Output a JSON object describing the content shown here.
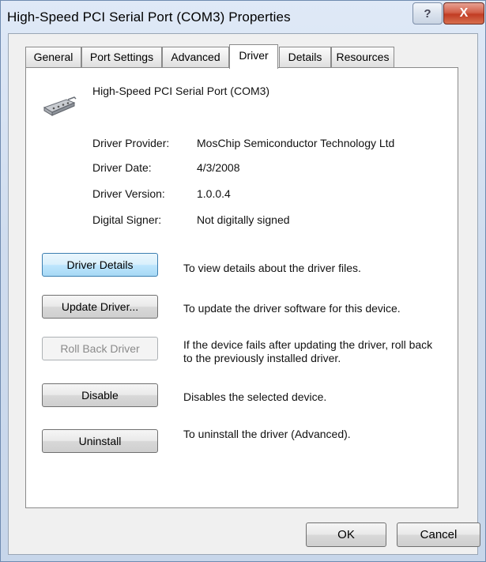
{
  "window": {
    "title": "High-Speed PCI Serial Port (COM3) Properties",
    "help_glyph": "?",
    "close_glyph": "X"
  },
  "tabs": [
    {
      "label": "General"
    },
    {
      "label": "Port Settings"
    },
    {
      "label": "Advanced"
    },
    {
      "label": "Driver",
      "active": true
    },
    {
      "label": "Details"
    },
    {
      "label": "Resources"
    }
  ],
  "device": {
    "icon": "serial-port-icon",
    "name": "High-Speed PCI Serial Port (COM3)"
  },
  "driver_info": {
    "provider_label": "Driver Provider:",
    "provider_value": "MosChip Semiconductor Technology Ltd",
    "date_label": "Driver Date:",
    "date_value": "4/3/2008",
    "version_label": "Driver Version:",
    "version_value": "1.0.0.4",
    "signer_label": "Digital Signer:",
    "signer_value": "Not digitally signed"
  },
  "actions": {
    "details_button": "Driver Details",
    "details_desc": "To view details about the driver files.",
    "update_button": "Update Driver...",
    "update_desc": "To update the driver software for this device.",
    "rollback_button": "Roll Back Driver",
    "rollback_desc": "If the device fails after updating the driver, roll back to the previously installed driver.",
    "disable_button": "Disable",
    "disable_desc": "Disables the selected device.",
    "uninstall_button": "Uninstall",
    "uninstall_desc": "To uninstall the driver (Advanced)."
  },
  "footer": {
    "ok_label": "OK",
    "cancel_label": "Cancel"
  },
  "colors": {
    "frame": "#cfdcee",
    "close_button": "#c13c24",
    "focus_button": "#bee6fd"
  }
}
